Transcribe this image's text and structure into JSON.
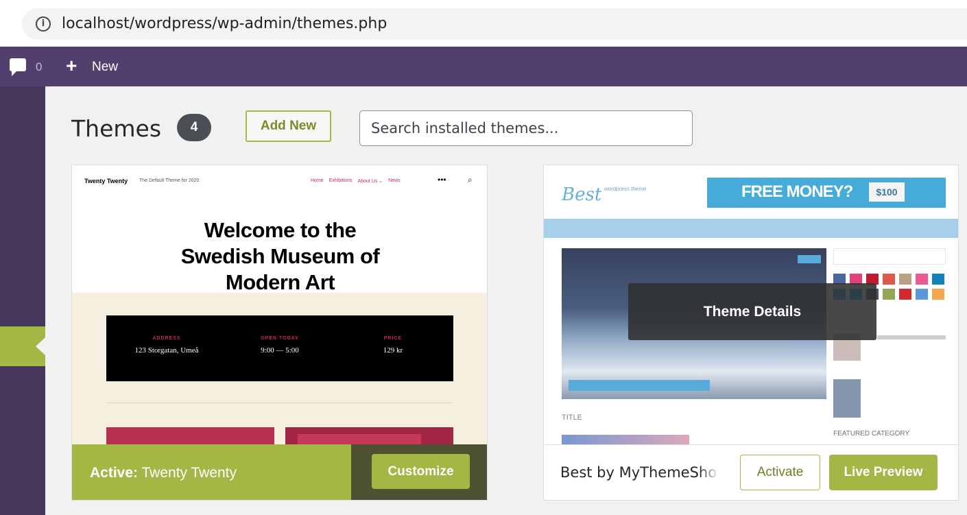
{
  "browser": {
    "url": "localhost/wordpress/wp-admin/themes.php",
    "info_glyph": "i"
  },
  "adminbar": {
    "comment_count": "0",
    "new_label": "New",
    "plus_glyph": "+"
  },
  "page": {
    "title": "Themes",
    "theme_count": "4",
    "add_new_label": "Add New",
    "search_placeholder": "Search installed themes..."
  },
  "themes": [
    {
      "name": "Twenty Twenty",
      "active_prefix": "Active:",
      "customize_label": "Customize",
      "screenshot": {
        "brand": "Twenty Twenty",
        "tagline": "The Default Theme for 2020",
        "nav": [
          "Home",
          "Exhibitions",
          "About Us ⌄",
          "News"
        ],
        "heading": "Welcome to the Swedish Museum of Modern Art",
        "info": [
          {
            "label": "ADDRESS",
            "value": "123 Storgatan, Umeå"
          },
          {
            "label": "OPEN TODAY",
            "value": "9:00 — 5:00"
          },
          {
            "label": "PRICE",
            "value": "129 kr"
          }
        ]
      }
    },
    {
      "name": "Best by MyThemeSho",
      "activate_label": "Activate",
      "live_preview_label": "Live Preview",
      "details_label": "Theme Details",
      "screenshot": {
        "logo": "Best",
        "logo_sub": "wordpress theme",
        "banner": "FREE MONEY?",
        "banner_price": "$100",
        "section_title": "TITLE",
        "featured": "FEATURED CATEGORY"
      }
    }
  ],
  "colors": {
    "admin_bar": "#523f6d",
    "sidebar": "#46365c",
    "accent": "#a3b745"
  }
}
